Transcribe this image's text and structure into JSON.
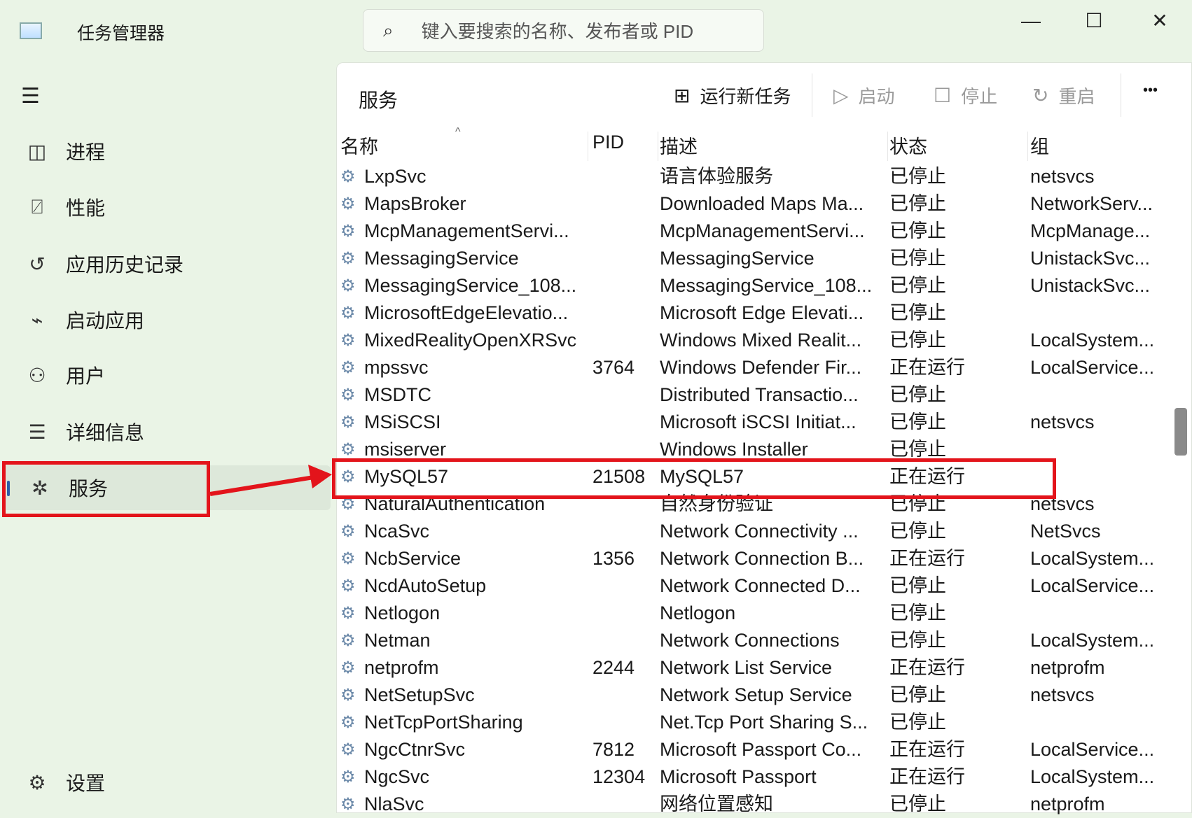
{
  "app": {
    "title": "任务管理器",
    "search_placeholder": "键入要搜索的名称、发布者或 PID",
    "min": "—",
    "max": "☐",
    "close": "✕"
  },
  "nav": [
    {
      "label": "进程",
      "icon": "processes-icon",
      "glyph": "◫"
    },
    {
      "label": "性能",
      "icon": "performance-icon",
      "glyph": "⍁"
    },
    {
      "label": "应用历史记录",
      "icon": "history-icon",
      "glyph": "↺"
    },
    {
      "label": "启动应用",
      "icon": "startup-icon",
      "glyph": "⌁"
    },
    {
      "label": "用户",
      "icon": "users-icon",
      "glyph": "⚇"
    },
    {
      "label": "详细信息",
      "icon": "details-icon",
      "glyph": "☰"
    },
    {
      "label": "服务",
      "icon": "services-icon",
      "glyph": "✲"
    }
  ],
  "settings": "设置",
  "panel": {
    "title": "服务",
    "run_new": "运行新任务",
    "start": "启动",
    "stop": "停止",
    "restart": "重启",
    "more": "•••"
  },
  "columns": [
    "名称",
    "PID",
    "描述",
    "状态",
    "组"
  ],
  "rows": [
    [
      "LxpSvc",
      "",
      "语言体验服务",
      "已停止",
      "netsvcs"
    ],
    [
      "MapsBroker",
      "",
      "Downloaded Maps Ma...",
      "已停止",
      "NetworkServ..."
    ],
    [
      "McpManagementServi...",
      "",
      "McpManagementServi...",
      "已停止",
      "McpManage..."
    ],
    [
      "MessagingService",
      "",
      "MessagingService",
      "已停止",
      "UnistackSvc..."
    ],
    [
      "MessagingService_108...",
      "",
      "MessagingService_108...",
      "已停止",
      "UnistackSvc..."
    ],
    [
      "MicrosoftEdgeElevatio...",
      "",
      "Microsoft Edge Elevati...",
      "已停止",
      ""
    ],
    [
      "MixedRealityOpenXRSvc",
      "",
      "Windows Mixed Realit...",
      "已停止",
      "LocalSystem..."
    ],
    [
      "mpssvc",
      "3764",
      "Windows Defender Fir...",
      "正在运行",
      "LocalService..."
    ],
    [
      "MSDTC",
      "",
      "Distributed Transactio...",
      "已停止",
      ""
    ],
    [
      "MSiSCSI",
      "",
      "Microsoft iSCSI Initiat...",
      "已停止",
      "netsvcs"
    ],
    [
      "msiserver",
      "",
      "Windows Installer",
      "已停止",
      ""
    ],
    [
      "MySQL57",
      "21508",
      "MySQL57",
      "正在运行",
      ""
    ],
    [
      "NaturalAuthentication",
      "",
      "自然身份验证",
      "已停止",
      "netsvcs"
    ],
    [
      "NcaSvc",
      "",
      "Network Connectivity ...",
      "已停止",
      "NetSvcs"
    ],
    [
      "NcbService",
      "1356",
      "Network Connection B...",
      "正在运行",
      "LocalSystem..."
    ],
    [
      "NcdAutoSetup",
      "",
      "Network Connected D...",
      "已停止",
      "LocalService..."
    ],
    [
      "Netlogon",
      "",
      "Netlogon",
      "已停止",
      ""
    ],
    [
      "Netman",
      "",
      "Network Connections",
      "已停止",
      "LocalSystem..."
    ],
    [
      "netprofm",
      "2244",
      "Network List Service",
      "正在运行",
      "netprofm"
    ],
    [
      "NetSetupSvc",
      "",
      "Network Setup Service",
      "已停止",
      "netsvcs"
    ],
    [
      "NetTcpPortSharing",
      "",
      "Net.Tcp Port Sharing S...",
      "已停止",
      ""
    ],
    [
      "NgcCtnrSvc",
      "7812",
      "Microsoft Passport Co...",
      "正在运行",
      "LocalService..."
    ],
    [
      "NgcSvc",
      "12304",
      "Microsoft Passport",
      "正在运行",
      "LocalSystem..."
    ],
    [
      "NlaSvc",
      "",
      "网络位置感知",
      "已停止",
      "netprofm"
    ]
  ],
  "colors": {
    "highlight": "#e3141b",
    "accent": "#2c5fa8"
  }
}
